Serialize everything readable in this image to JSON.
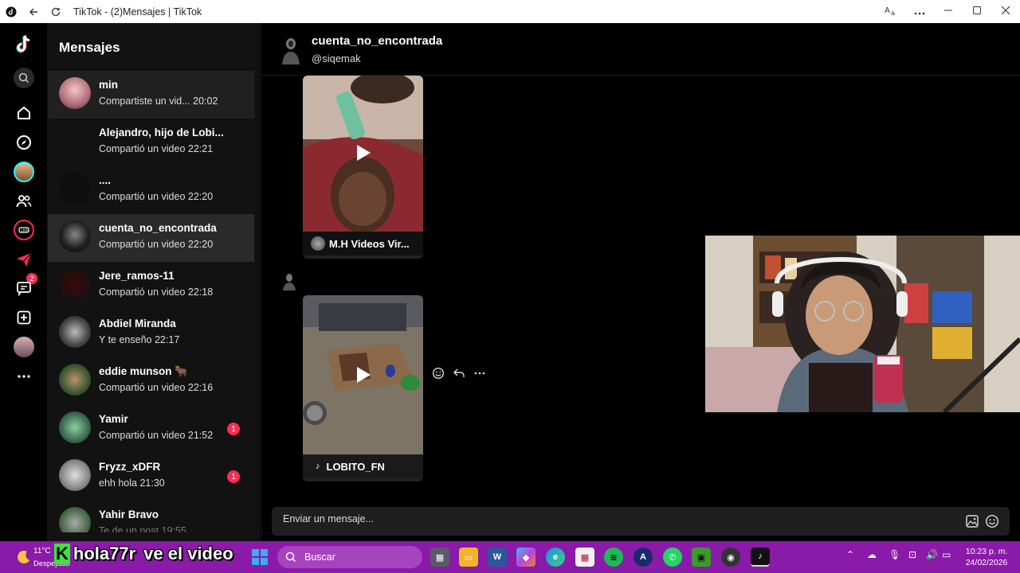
{
  "window": {
    "title": "TikTok - (2)Mensajes | TikTok"
  },
  "rail": {
    "notification_badge": "2"
  },
  "sidebar": {
    "header": "Mensajes",
    "conversations": [
      {
        "name": "min",
        "preview": "Compartiste un vid...",
        "time": "20:02",
        "unread": ""
      },
      {
        "name": "Alejandro, hijo de Lobi...",
        "preview": "Compartió un video",
        "time": "22:21",
        "unread": ""
      },
      {
        "name": "....",
        "preview": "Compartió un video",
        "time": "22:20",
        "unread": ""
      },
      {
        "name": "cuenta_no_encontrada",
        "preview": "Compartió un video",
        "time": "22:20",
        "unread": ""
      },
      {
        "name": "Jere_ramos-11",
        "preview": "Compartió un video",
        "time": "22:18",
        "unread": ""
      },
      {
        "name": "Abdiel Miranda",
        "preview": "Y te enseño",
        "time": "22:17",
        "unread": ""
      },
      {
        "name": "eddie munson 🐂",
        "preview": "Compartió un video",
        "time": "22:16",
        "unread": ""
      },
      {
        "name": "Yamir",
        "preview": "Compartió un video",
        "time": "21:52",
        "unread": "1"
      },
      {
        "name": "Fryzz_xDFR",
        "preview": "ehh hola",
        "time": "21:30",
        "unread": "1"
      },
      {
        "name": "Yahir Bravo",
        "preview": "Te de un post",
        "time": "19:55",
        "unread": ""
      }
    ]
  },
  "chat": {
    "name": "cuenta_no_encontrada",
    "handle": "@siqemak",
    "messages": [
      {
        "type": "video",
        "caption": "M.H Videos Vir..."
      },
      {
        "type": "video",
        "caption": "LOBITO_FN"
      }
    ],
    "composer_placeholder": "Enviar un mensaje..."
  },
  "taskbar": {
    "weather_temp": "11°C",
    "weather_cond": "Despejado",
    "overlay_user": "hola77r",
    "overlay_msg": "ve el video",
    "search_label": "Buscar",
    "time": "10:23 p. m.",
    "date": "24/02/2026"
  },
  "colors": {
    "accent": "#fe2c55",
    "taskbar": "#8a1aa8"
  }
}
